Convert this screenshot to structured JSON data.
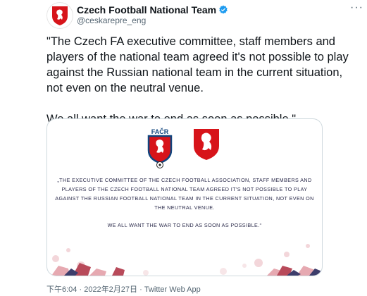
{
  "account": {
    "display_name": "Czech Football National Team",
    "handle": "@ceskarepre_eng",
    "verified": true,
    "avatar_icon": "czech-lion-crest-icon"
  },
  "tweet": {
    "text": "\"The Czech FA executive committee, staff members and players of the national team agreed it's not possible to play against the Russian national team in the current situation, not even on the neutral venue.\n\nWe all want the war to end as soon as possible.\""
  },
  "media": {
    "logo_left_text": "FAČR",
    "statement_1": "„The executive committee of the Czech football association, staff members and players of the Czech football national team agreed it's not possible to play against the Russian football national team in the current situation, not even on the neutral venue.",
    "statement_2": "We all want the war to end as soon as possible.“"
  },
  "footer": {
    "time": "下午6:04",
    "separator": " · ",
    "date": "2022年2月27日",
    "source": "Twitter Web App"
  },
  "colors": {
    "accent": "#1d9bf0",
    "crest_red": "#d7141a",
    "crest_blue": "#11457e",
    "text": "#0f1419",
    "secondary": "#536471"
  }
}
